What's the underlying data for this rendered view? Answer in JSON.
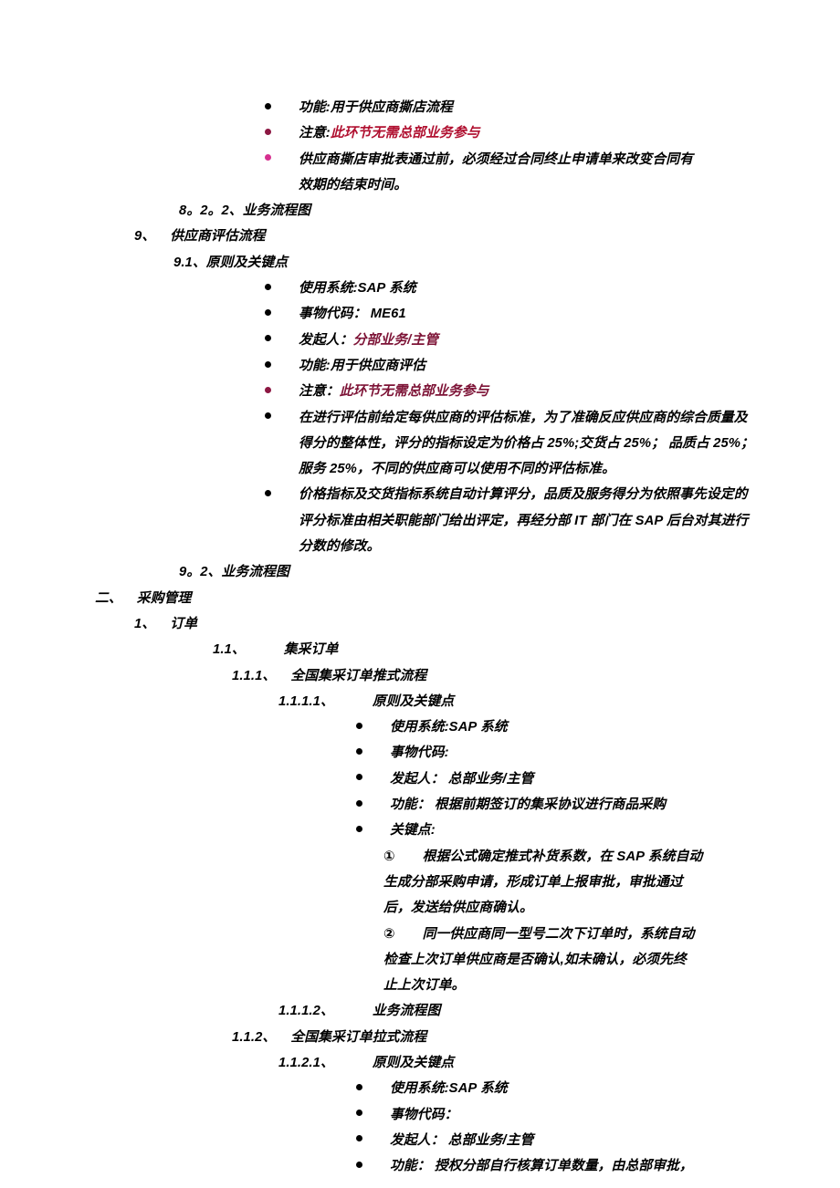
{
  "document": {
    "colors": {
      "text": "#000000",
      "crimson": "#b01030",
      "maroon": "#7d1336",
      "bullet_dark_red": "#8c1742",
      "bullet_magenta": "#d6308f"
    },
    "blocks": [
      {
        "id": "b1",
        "marker": "•",
        "text": "功能:用于供应商撕店流程"
      },
      {
        "id": "b2",
        "marker": "•",
        "label": "注意:",
        "text": "此环节无需总部业务参与"
      },
      {
        "id": "b3",
        "marker": "•",
        "line1": "供应商撕店审批表通过前，必须经过合同终止申请单来改变合同有",
        "line2": "效期的结束时间。"
      },
      {
        "id": "h822",
        "number": "8。2。2、",
        "title": "业务流程图"
      },
      {
        "id": "h9",
        "number": "9、",
        "title": "供应商评估流程"
      },
      {
        "id": "h91",
        "number": "9.1、",
        "title": "原则及关键点"
      },
      {
        "id": "b91a",
        "marker": "•",
        "text": "使用系统:SAP 系统"
      },
      {
        "id": "b91b",
        "marker": "•",
        "text": "事物代码： ME61"
      },
      {
        "id": "b91c",
        "marker": "•",
        "label": "发起人：",
        "text": "分部业务/主管"
      },
      {
        "id": "b91d",
        "marker": "•",
        "text": "功能:用于供应商评估"
      },
      {
        "id": "b91e",
        "marker": "•",
        "label": "注意：",
        "text": "此环节无需总部业务参与"
      },
      {
        "id": "b91f",
        "marker": "•",
        "line1": "在进行评估前给定每供应商的评估标准，为了准确反应供应商的综合质量及",
        "line2": "得分的整体性，评分的指标设定为价格占 25%;交货占 25%； 品质占 25%；",
        "line3": "服务 25%，不同的供应商可以使用不同的评估标准。"
      },
      {
        "id": "b91g",
        "marker": "•",
        "line1": "价格指标及交货指标系统自动计算评分，品质及服务得分为依照事先设定的",
        "line2": "评分标准由相关职能部门给出评定，再经分部 IT 部门在 SAP 后台对其进行",
        "line3": "分数的修改。"
      },
      {
        "id": "h92",
        "number": "9。2、",
        "title": "业务流程图"
      },
      {
        "id": "h2",
        "number": "二、",
        "title": "采购管理"
      },
      {
        "id": "h1",
        "number": "1、",
        "title": "订单"
      },
      {
        "id": "h11",
        "number": "1.1、",
        "title": "集采订单"
      },
      {
        "id": "h111",
        "number": "1.1.1、",
        "title": "全国集采订单推式流程"
      },
      {
        "id": "h1111",
        "number": "1.1.1.1、",
        "title": "原则及关键点"
      },
      {
        "id": "c1a",
        "marker": "•",
        "text": "使用系统:SAP 系统"
      },
      {
        "id": "c1b",
        "marker": "•",
        "text": "事物代码:"
      },
      {
        "id": "c1c",
        "marker": "•",
        "text": "发起人： 总部业务/主管"
      },
      {
        "id": "c1d",
        "marker": "•",
        "text": "功能： 根据前期签订的集采协议进行商品采购"
      },
      {
        "id": "c1e",
        "marker": "•",
        "text": "关键点:"
      },
      {
        "id": "n1",
        "number": "①",
        "line1": "根据公式确定推式补货系数，在 SAP 系统自动",
        "line2": "生成分部采购申请，形成订单上报审批，审批通过",
        "line3": "后，发送给供应商确认。"
      },
      {
        "id": "n2",
        "number": "②",
        "line1": "同一供应商同一型号二次下订单时，系统自动",
        "line2": "检查上次订单供应商是否确认,如未确认，必须先终",
        "line3": "止上次订单。"
      },
      {
        "id": "h1112",
        "number": "1.1.1.2、",
        "title": "业务流程图"
      },
      {
        "id": "h112",
        "number": "1.1.2、",
        "title": "全国集采订单拉式流程"
      },
      {
        "id": "h1121",
        "number": "1.1.2.1、",
        "title": "原则及关键点"
      },
      {
        "id": "c2a",
        "marker": "•",
        "text": "使用系统:SAP 系统"
      },
      {
        "id": "c2b",
        "marker": "•",
        "text": "事物代码："
      },
      {
        "id": "c2c",
        "marker": "•",
        "text": "发起人： 总部业务/主管"
      },
      {
        "id": "c2d",
        "marker": "•",
        "text": "功能： 授权分部自行核算订单数量，由总部审批，"
      }
    ]
  }
}
